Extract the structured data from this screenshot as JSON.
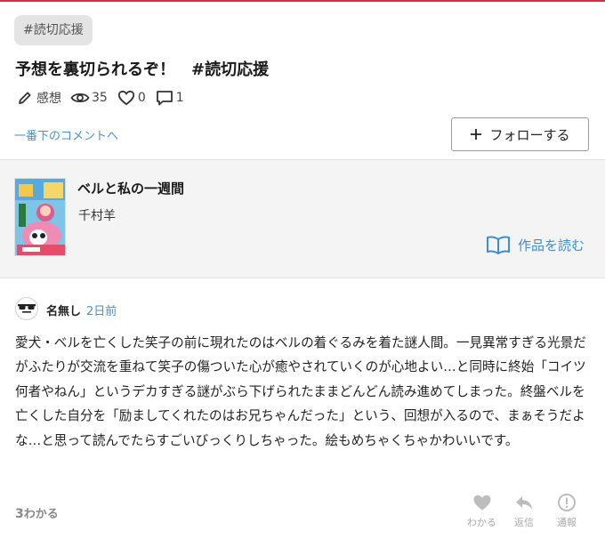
{
  "post": {
    "tag": "#読切応援",
    "title": "予想を裏切られるぞ！　#読切応援",
    "category": "感想",
    "views": "35",
    "likes": "0",
    "comments": "1"
  },
  "actions": {
    "jump_to_bottom": "一番下のコメントへ",
    "follow": "フォローする"
  },
  "book": {
    "title": "ベルと私の一週間",
    "author": "千村羊",
    "read_label": "作品を読む"
  },
  "comment": {
    "user": "名無し",
    "time": "2日前",
    "body": "愛犬・ベルを亡くした笑子の前に現れたのはベルの着ぐるみを着た謎人間。一見異常すぎる光景だがふたりが交流を重ねて笑子の傷ついた心が癒やされていくのが心地よい…と同時に終始「コイツ何者やねん」というデカすぎる謎がぶら下げられたままどんどん読み進めてしまった。終盤ベルを亡くした自分を「励ましてくれたのはお兄ちゃんだった」という、回想が入るので、まぁそうだよな…と思って読んでたらすごいびっくりしちゃった。絵もめちゃくちゃかわいいです。",
    "wakaru_count": "3",
    "wakaru_count_suffix": "わかる",
    "wakaru_label": "わかる",
    "reply_label": "返信",
    "report_label": "通報"
  },
  "colors": {
    "accent_red": "#e0284a",
    "link_blue": "#4a90c8",
    "read_blue": "#3c8fcf"
  },
  "icons": [
    "pencil-icon",
    "eye-icon",
    "heart-icon",
    "comment-icon",
    "plus-icon",
    "book-open-icon",
    "sunglasses-avatar-icon",
    "heart-filled-icon",
    "reply-arrow-icon",
    "warning-circle-icon"
  ]
}
